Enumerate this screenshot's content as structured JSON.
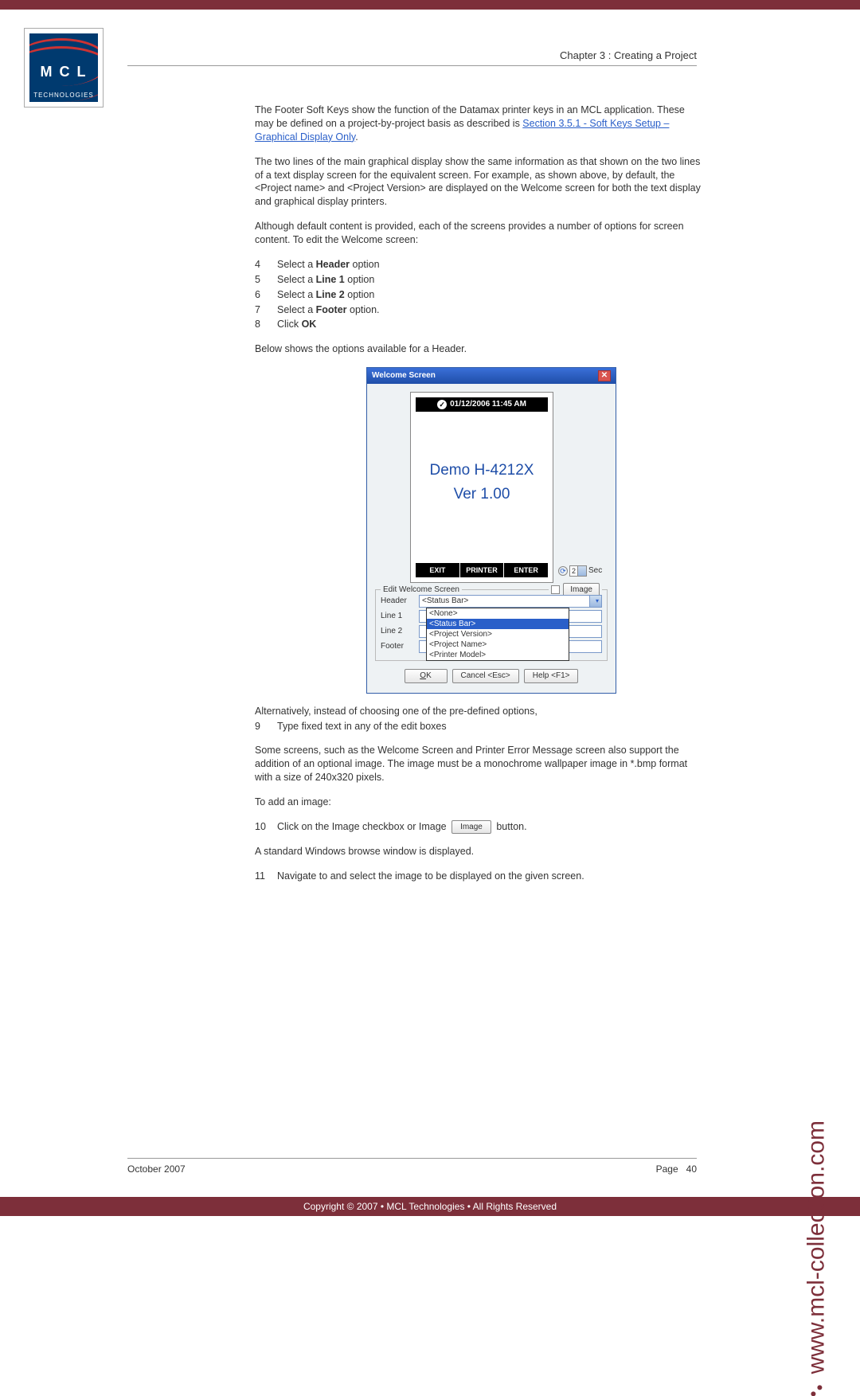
{
  "chapter": "Chapter 3 : Creating a Project",
  "logo": {
    "mcl": "M C L",
    "sub": "TECHNOLOGIES"
  },
  "para1_a": "The Footer Soft Keys show the function of the Datamax printer keys in an MCL application. These may be defined on a project-by-project basis as described is ",
  "para1_link": "Section 3.5.1 - Soft Keys Setup – Graphical Display Only",
  "para1_b": ".",
  "para2": "The two lines of the main graphical display show the same information as that shown on the two lines of a text display screen for the equivalent screen. For example, as shown above, by default, the <Project name> and <Project Version> are displayed on the Welcome screen for both the text display and graphical display printers.",
  "para3": "Although default content is provided, each of the screens provides a number of options for screen content. To edit the Welcome screen:",
  "steps_a": [
    {
      "n": "4",
      "t1": "Select a ",
      "b": "Header",
      "t2": " option"
    },
    {
      "n": "5",
      "t1": "Select a ",
      "b": "Line 1",
      "t2": " option"
    },
    {
      "n": "6",
      "t1": "Select a ",
      "b": "Line 2",
      "t2": " option"
    },
    {
      "n": "7",
      "t1": "Select a ",
      "b": "Footer",
      "t2": " option."
    },
    {
      "n": "8",
      "t1": "Click ",
      "b": "OK",
      "t2": ""
    }
  ],
  "para4": "Below shows the options available for a Header.",
  "dialog": {
    "title": "Welcome Screen",
    "status": "01/12/2006 11:45 AM",
    "demo1": "Demo H-4212X",
    "demo2": "Ver 1.00",
    "softkeys": [
      "EXIT",
      "PRINTER",
      "ENTER"
    ],
    "sec_val": "2",
    "sec_label": "Sec",
    "fieldset": "Edit Welcome Screen",
    "image_btn": "Image",
    "rows": [
      {
        "label": "Header",
        "value": "<Status Bar>",
        "dropdown": true
      },
      {
        "label": "Line 1",
        "value": ""
      },
      {
        "label": "Line 2",
        "value": ""
      },
      {
        "label": "Footer",
        "value": ""
      }
    ],
    "dd_items": [
      "<None>",
      "<Status Bar>",
      "<Project Version>",
      "<Project Name>",
      "<Printer Model>"
    ],
    "dd_selected": 1,
    "buttons": {
      "ok": "OK",
      "ok_u": "O",
      "cancel": "Cancel <Esc>",
      "help": "Help <F1>"
    }
  },
  "para5": "Alternatively, instead of choosing one of the pre-defined options,",
  "step9": {
    "n": "9",
    "t": "Type fixed text in any of the edit boxes"
  },
  "para6": "Some screens, such as the Welcome Screen and Printer Error Message screen also support the addition of an optional image. The image must be a monochrome wallpaper image in *.bmp format with a size of 240x320 pixels.",
  "para7": "To add an image:",
  "step10": {
    "n": "10",
    "t1": "Click on the Image checkbox or Image ",
    "btn": "Image",
    "t2": " button."
  },
  "para8": "A standard Windows browse window is displayed.",
  "step11": {
    "n": "11",
    "t": "Navigate to and select the image to be displayed on the given screen."
  },
  "footer_date": "October 2007",
  "footer_page_label": "Page",
  "footer_page_num": "40",
  "copyright": "Copyright © 2007 • MCL Technologies • All Rights Reserved",
  "side_url": "www.mcl-collection.com"
}
